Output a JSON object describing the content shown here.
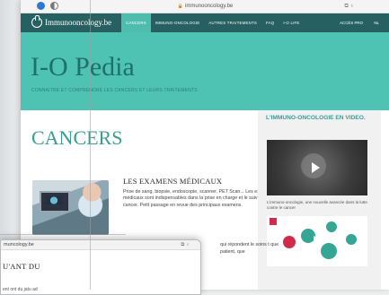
{
  "browser": {
    "url": "immunooncology.be",
    "right_icons": "⧉ ♁"
  },
  "nav": {
    "logo": "Immunooncology.be",
    "items": [
      "CANCERS",
      "IMMUNO-ONCOLOGIE",
      "AUTRES TRAITEMENTS",
      "FAQ",
      "I-O LIFE"
    ],
    "pro": "ACCÈS PRO",
    "lang": "NL"
  },
  "hero": {
    "title": "I-O Pedia",
    "subtitle": "CONNAITRE ET COMPRENDRE LES CANCERS ET LEURS TRAITEMENTS"
  },
  "content": {
    "heading": "CANCERS",
    "article": {
      "title": "LES EXAMENS MÉDICAUX",
      "body": "Prise de sang, biopsie, endoscopie, scanner, PET Scan... Les examens médicaux sont indispensables dans la prise en charge et le suivi d'un cancer. Petit passage en revue des principaux examens."
    },
    "right_fragment": "qui répondent le soins t que patient, que"
  },
  "sidebar": {
    "title": "L'IMMUNO-ONCOLOGIE EN VIDEO.",
    "caption": "L'immuno-oncologie, une nouvelle avancée dans la lutte contre le cancer"
  },
  "window2": {
    "url": "muncology.be",
    "right_icons": "⧉ ♁",
    "heading": "U'ANT DU",
    "text": "ent ont du jatu ad"
  },
  "colors": {
    "nav": "#266060",
    "hero": "#4fc3b3",
    "accent": "#3a9d91"
  }
}
